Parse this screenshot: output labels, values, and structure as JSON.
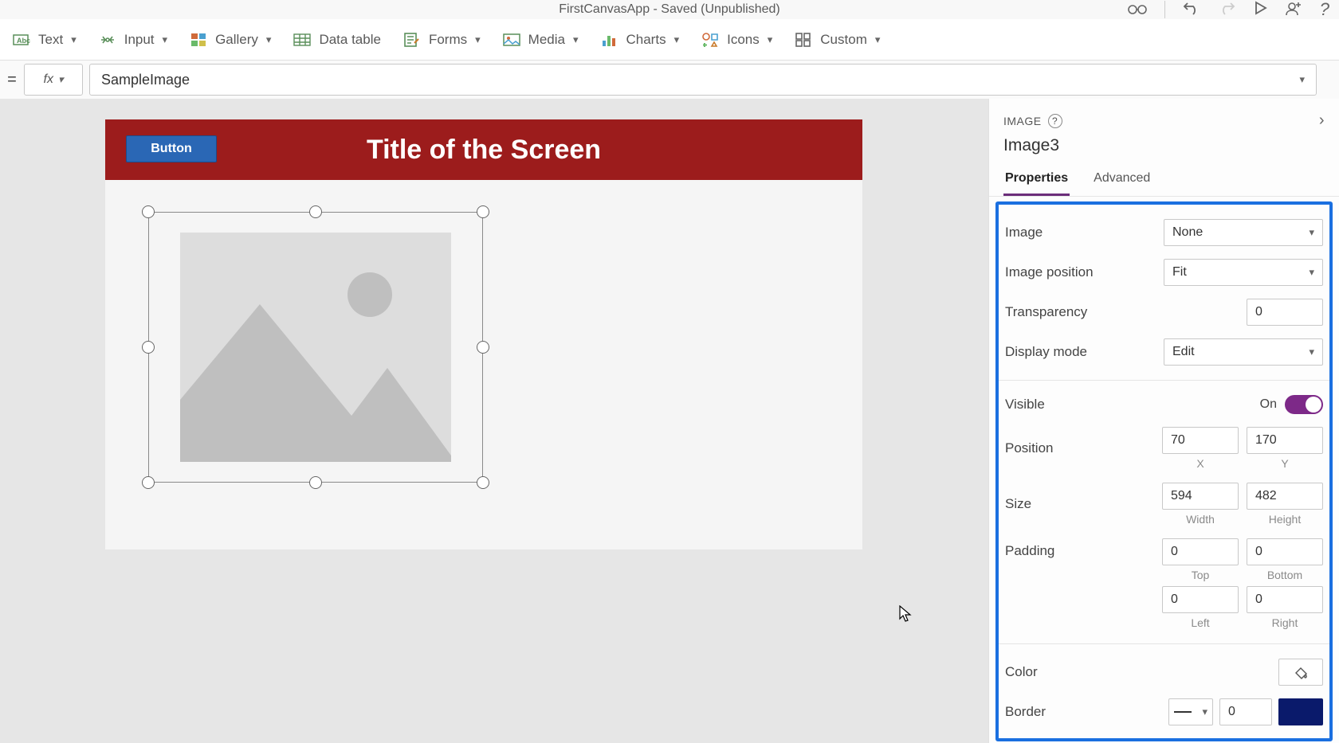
{
  "titlebar": {
    "text": "FirstCanvasApp - Saved (Unpublished)"
  },
  "ribbon": {
    "text": "Text",
    "input": "Input",
    "gallery": "Gallery",
    "datatable": "Data table",
    "forms": "Forms",
    "media": "Media",
    "charts": "Charts",
    "icons": "Icons",
    "custom": "Custom"
  },
  "formula": {
    "eq": "=",
    "fx": "fx",
    "expr": "SampleImage"
  },
  "canvas": {
    "button": "Button",
    "title": "Title of the Screen"
  },
  "panel": {
    "section": "IMAGE",
    "name": "Image3",
    "tab_properties": "Properties",
    "tab_advanced": "Advanced"
  },
  "props": {
    "image": {
      "lbl": "Image",
      "val": "None"
    },
    "image_position": {
      "lbl": "Image position",
      "val": "Fit"
    },
    "transparency": {
      "lbl": "Transparency",
      "val": "0"
    },
    "display_mode": {
      "lbl": "Display mode",
      "val": "Edit"
    },
    "visible": {
      "lbl": "Visible",
      "on": "On"
    },
    "position": {
      "lbl": "Position",
      "x": "70",
      "y": "170",
      "xl": "X",
      "yl": "Y"
    },
    "size": {
      "lbl": "Size",
      "w": "594",
      "h": "482",
      "wl": "Width",
      "hl": "Height"
    },
    "padding": {
      "lbl": "Padding",
      "t": "0",
      "b": "0",
      "l": "0",
      "r": "0",
      "tl": "Top",
      "bl": "Bottom",
      "ll": "Left",
      "rl": "Right"
    },
    "color": {
      "lbl": "Color"
    },
    "border": {
      "lbl": "Border",
      "val": "0"
    }
  }
}
